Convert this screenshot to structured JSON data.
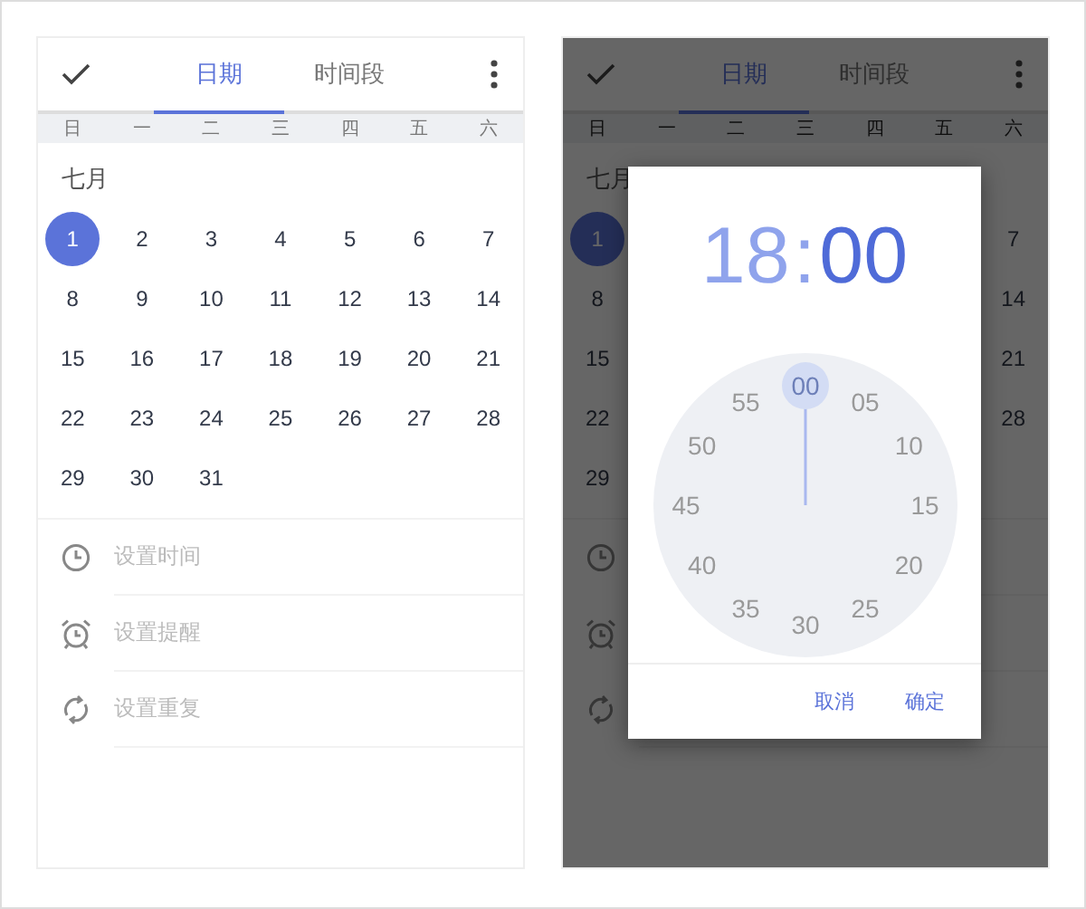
{
  "screens": [
    {
      "kind": "calendar",
      "toolbar": {
        "tabs": [
          {
            "label": "日期",
            "selected": true
          },
          {
            "label": "时间段",
            "selected": false
          }
        ]
      },
      "weekdays": [
        "日",
        "一",
        "二",
        "三",
        "四",
        "五",
        "六"
      ],
      "month": "七月",
      "weeks": [
        [
          {
            "day": "1",
            "selected": true
          },
          {
            "day": "2",
            "selected": false
          },
          {
            "day": "3",
            "selected": false
          },
          {
            "day": "4",
            "selected": false
          },
          {
            "day": "5",
            "selected": false
          },
          {
            "day": "6",
            "selected": false
          },
          {
            "day": "7",
            "selected": false
          }
        ],
        [
          {
            "day": "8",
            "selected": false
          },
          {
            "day": "9",
            "selected": false
          },
          {
            "day": "10",
            "selected": false
          },
          {
            "day": "11",
            "selected": false
          },
          {
            "day": "12",
            "selected": false
          },
          {
            "day": "13",
            "selected": false
          },
          {
            "day": "14",
            "selected": false
          }
        ],
        [
          {
            "day": "15",
            "selected": false
          },
          {
            "day": "16",
            "selected": false
          },
          {
            "day": "17",
            "selected": false
          },
          {
            "day": "18",
            "selected": false
          },
          {
            "day": "19",
            "selected": false
          },
          {
            "day": "20",
            "selected": false
          },
          {
            "day": "21",
            "selected": false
          }
        ],
        [
          {
            "day": "22",
            "selected": false
          },
          {
            "day": "23",
            "selected": false
          },
          {
            "day": "24",
            "selected": false
          },
          {
            "day": "25",
            "selected": false
          },
          {
            "day": "26",
            "selected": false
          },
          {
            "day": "27",
            "selected": false
          },
          {
            "day": "28",
            "selected": false
          }
        ],
        [
          {
            "day": "29",
            "selected": false
          },
          {
            "day": "30",
            "selected": false
          },
          {
            "day": "31",
            "selected": false
          }
        ]
      ],
      "options": [
        {
          "kind": "clock",
          "label": "设置时间"
        },
        {
          "kind": "alarm",
          "label": "设置提醒"
        },
        {
          "kind": "repeat",
          "label": "设置重复"
        }
      ]
    },
    {
      "kind": "calendar_dimmed",
      "toolbar": {
        "tabs": [
          {
            "label": "日期",
            "selected": true
          },
          {
            "label": "时间段",
            "selected": false
          }
        ]
      },
      "weekdays": [
        "日",
        "一",
        "二",
        "三",
        "四",
        "五",
        "六"
      ],
      "month": "七月",
      "left_column": [
        {
          "day": "1",
          "selected": true
        },
        {
          "day": "8",
          "selected": false
        },
        {
          "day": "15",
          "selected": false
        },
        {
          "day": "22",
          "selected": false
        },
        {
          "day": "29",
          "selected": false
        }
      ],
      "right_column": [
        {
          "day": "7",
          "selected": false
        },
        {
          "day": "14",
          "selected": false
        },
        {
          "day": "21",
          "selected": false
        },
        {
          "day": "28",
          "selected": false
        }
      ],
      "options": [
        {
          "kind": "clock"
        },
        {
          "kind": "alarm"
        },
        {
          "kind": "repeat"
        }
      ],
      "dialog": {
        "time": {
          "hours": {
            "text": "18",
            "selected": false
          },
          "separator": ":",
          "minutes": {
            "text": "00",
            "selected": true
          }
        },
        "dial": [
          {
            "label": "00",
            "selected": true
          },
          {
            "label": "05",
            "selected": false
          },
          {
            "label": "10",
            "selected": false
          },
          {
            "label": "15",
            "selected": false
          },
          {
            "label": "20",
            "selected": false
          },
          {
            "label": "25",
            "selected": false
          },
          {
            "label": "30",
            "selected": false
          },
          {
            "label": "35",
            "selected": false
          },
          {
            "label": "40",
            "selected": false
          },
          {
            "label": "45",
            "selected": false
          },
          {
            "label": "50",
            "selected": false
          },
          {
            "label": "55",
            "selected": false
          }
        ],
        "buttons": [
          "取消",
          "确定"
        ]
      }
    }
  ]
}
